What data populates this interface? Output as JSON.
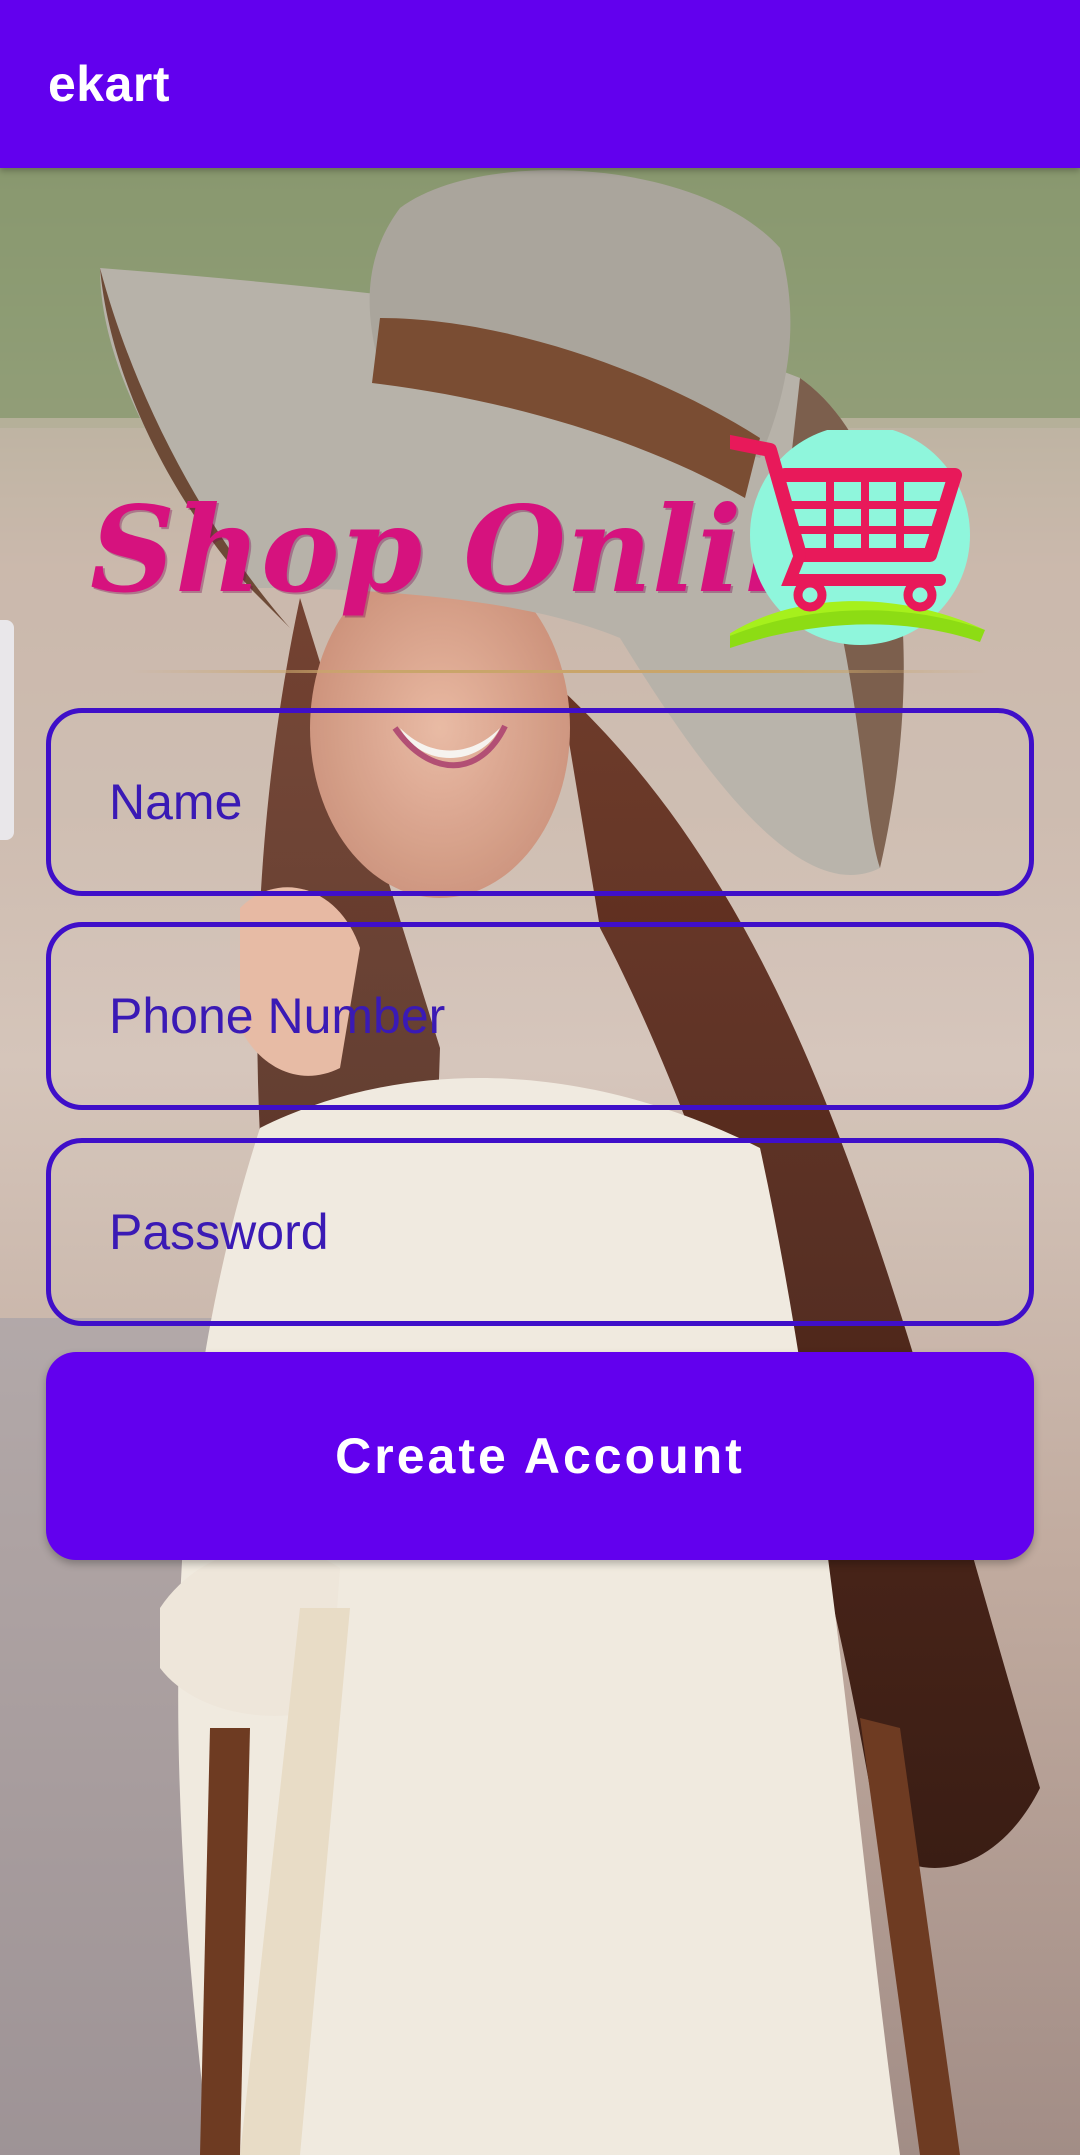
{
  "app_bar": {
    "title": "ekart",
    "color": "#6200ee"
  },
  "background": {
    "description_icon": "photo-woman-hat"
  },
  "logo": {
    "text": "Shop Online",
    "icon": "shopping-cart-icon",
    "text_color": "#d6127e"
  },
  "form": {
    "name_placeholder": "Name",
    "phone_placeholder": "Phone Number",
    "password_placeholder": "Password",
    "border_color": "#3f0fc9"
  },
  "actions": {
    "create_account_label": "Create Account"
  }
}
